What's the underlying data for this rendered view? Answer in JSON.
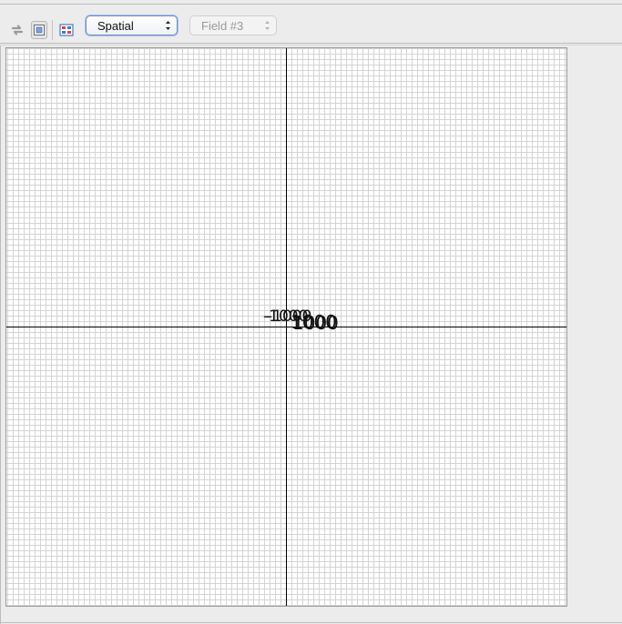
{
  "toolbar": {
    "refresh_icon": "refresh-arrows-icon",
    "display_icon": "monitor-icon",
    "grid_icon": "grid-settings-icon",
    "view_select": {
      "value": "Spatial"
    },
    "field_select": {
      "value": "Field #3",
      "disabled": true
    }
  },
  "plot": {
    "grid": true,
    "axis_labels": {
      "x_min": "-1000",
      "x_max": "1000",
      "y_min": "-1000",
      "y_max": "1000"
    }
  },
  "colors": {
    "grid_line": "#d4d4d4",
    "axis_line": "#000000",
    "plot_background": "#ffffff",
    "window_background": "#ececec",
    "select_focus": "#6f8bc9"
  }
}
